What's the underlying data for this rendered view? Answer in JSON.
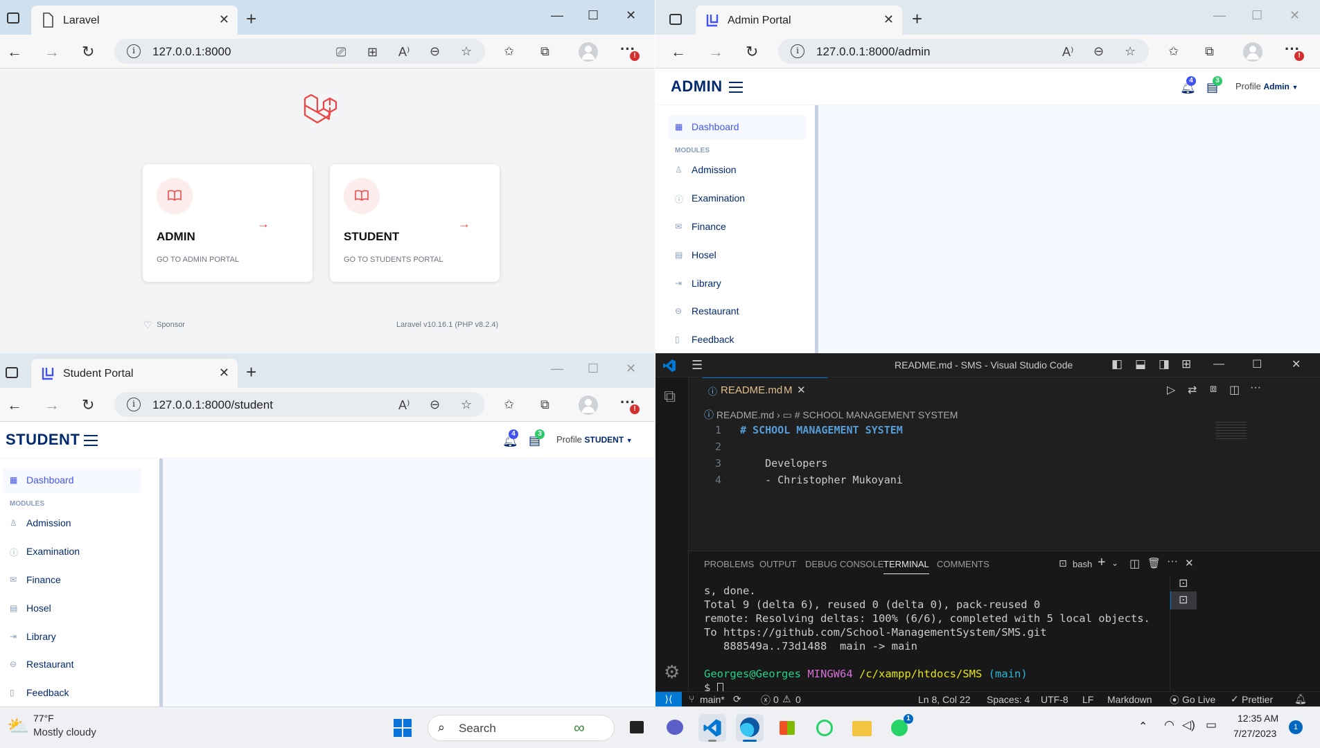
{
  "win_laravel": {
    "tab_title": "Laravel",
    "url": "127.0.0.1:8000",
    "cards": [
      {
        "title": "ADMIN",
        "subtitle": "GO TO ADMIN PORTAL"
      },
      {
        "title": "STUDENT",
        "subtitle": "GO TO STUDENTS PORTAL"
      }
    ],
    "sponsor": "Sponsor",
    "version": "Laravel v10.16.1 (PHP v8.2.4)"
  },
  "win_admin": {
    "tab_title": "Admin Portal",
    "url": "127.0.0.1:8000/admin",
    "logo": "ADMIN",
    "notif_count": "4",
    "msg_count": "3",
    "profile_alt": "Profile",
    "user": "Admin",
    "sidebar": {
      "dashboard": "Dashboard",
      "heading": "MODULES",
      "items": [
        "Admission",
        "Examination",
        "Finance",
        "Hosel",
        "Library",
        "Restaurant",
        "Feedback"
      ]
    }
  },
  "win_student": {
    "tab_title": "Student Portal",
    "url": "127.0.0.1:8000/student",
    "logo": "STUDENT",
    "notif_count": "4",
    "msg_count": "3",
    "profile_alt": "Profile",
    "user": "STUDENT",
    "sidebar": {
      "dashboard": "Dashboard",
      "heading": "MODULES",
      "items": [
        "Admission",
        "Examination",
        "Finance",
        "Hosel",
        "Library",
        "Restaurant",
        "Feedback"
      ]
    }
  },
  "vscode": {
    "title": "README.md - SMS - Visual Studio Code",
    "tab_label": "README.md",
    "tab_status": "M",
    "breadcrumb_file": "README.md",
    "breadcrumb_symbol": "# SCHOOL MANAGEMENT SYSTEM",
    "lines": [
      {
        "n": "1",
        "text": "# SCHOOL MANAGEMENT SYSTEM"
      },
      {
        "n": "2",
        "text": ""
      },
      {
        "n": "3",
        "text": "    Developers"
      },
      {
        "n": "4",
        "text": "    - Christopher Mukoyani"
      }
    ],
    "panel_tabs": [
      "PROBLEMS",
      "OUTPUT",
      "DEBUG CONSOLE",
      "TERMINAL",
      "COMMENTS"
    ],
    "active_panel": "TERMINAL",
    "shell": "bash",
    "terminal": [
      "s, done.",
      "Total 9 (delta 6), reused 0 (delta 0), pack-reused 0",
      "remote: Resolving deltas: 100% (6/6), completed with 5 local objects.",
      "To https://github.com/School-ManagementSystem/SMS.git",
      "   888549a..73d1488  main -> main"
    ],
    "prompt_user": "Georges@Georges",
    "prompt_env": "MINGW64",
    "prompt_path": "/c/xampp/htdocs/SMS",
    "prompt_branch": "(main)",
    "prompt_symbol": "$",
    "status": {
      "branch": "main*",
      "errors": "0",
      "warnings": "0",
      "position": "Ln 8, Col 22",
      "spaces": "Spaces: 4",
      "encoding": "UTF-8",
      "eol": "LF",
      "language": "Markdown",
      "golive": "Go Live",
      "prettier": "Prettier"
    }
  },
  "taskbar": {
    "temp": "77°F",
    "weather": "Mostly cloudy",
    "search": "Search",
    "time": "12:35 AM",
    "date": "7/27/2023",
    "notif": "1",
    "whatsapp_badge": "1"
  },
  "colors": {
    "laravel_red": "#ef4444",
    "portal_navy": "#012970",
    "portal_blue": "#4154f1",
    "vscode_blue": "#0078d4"
  }
}
